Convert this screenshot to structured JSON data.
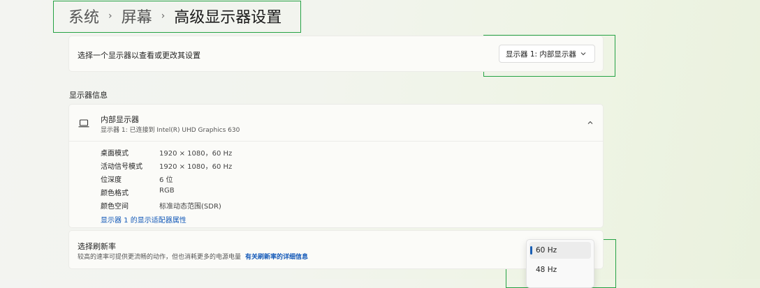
{
  "breadcrumb": {
    "items": [
      "系统",
      "屏幕"
    ],
    "current": "高级显示器设置"
  },
  "display_select": {
    "label": "选择一个显示器以查看或更改其设置",
    "selected": "显示器 1: 内部显示器"
  },
  "section_title": "显示器信息",
  "display_info": {
    "name": "内部显示器",
    "subtitle": "显示器 1: 已连接到 Intel(R) UHD Graphics 630",
    "properties": [
      {
        "key": "桌面模式",
        "value": "1920 × 1080，60 Hz"
      },
      {
        "key": "活动信号模式",
        "value": "1920 × 1080，60 Hz"
      },
      {
        "key": "位深度",
        "value": "6 位"
      },
      {
        "key": "颜色格式",
        "value": "RGB"
      },
      {
        "key": "颜色空间",
        "value": "标准动态范围(SDR)"
      }
    ],
    "adapter_link": "显示器 1 的显示适配器属性"
  },
  "refresh_rate": {
    "title": "选择刷新率",
    "description": "较高的速率可提供更流畅的动作，但也消耗更多的电源电量",
    "link": "有关刷新率的详细信息",
    "options": [
      "60 Hz",
      "48 Hz"
    ],
    "selected_index": 0
  },
  "colors": {
    "accent": "#1a5fb4",
    "link": "#1359b8",
    "highlight_box": "#25a244"
  }
}
